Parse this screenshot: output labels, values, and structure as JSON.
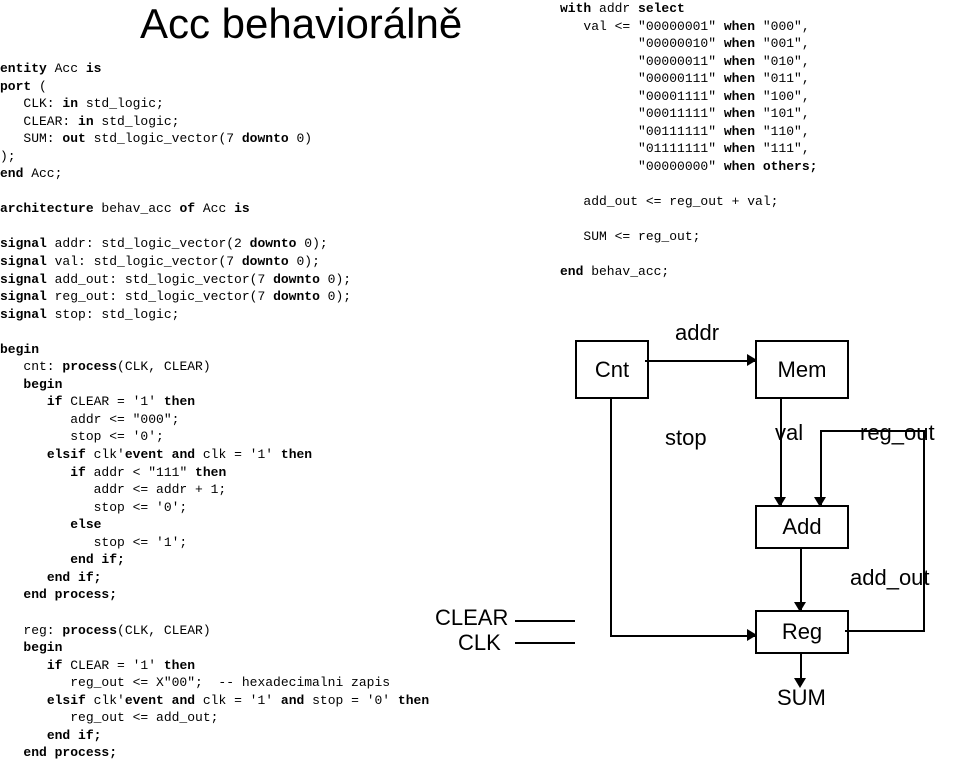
{
  "title": "Acc behaviorálně",
  "code_left": "<span class='kw'>entity</span> Acc <span class='kw'>is</span>\n<span class='kw'>port</span> (\n   CLK: <span class='kw'>in</span> std_logic;\n   CLEAR: <span class='kw'>in</span> std_logic;\n   SUM: <span class='kw'>out</span> std_logic_vector(7 <span class='kw'>downto</span> 0)\n);\n<span class='kw'>end</span> Acc;\n\n<span class='kw'>architecture</span> behav_acc <span class='kw'>of</span> Acc <span class='kw'>is</span>\n\n<span class='kw'>signal</span> addr: std_logic_vector(2 <span class='kw'>downto</span> 0);\n<span class='kw'>signal</span> val: std_logic_vector(7 <span class='kw'>downto</span> 0);\n<span class='kw'>signal</span> add_out: std_logic_vector(7 <span class='kw'>downto</span> 0);\n<span class='kw'>signal</span> reg_out: std_logic_vector(7 <span class='kw'>downto</span> 0);\n<span class='kw'>signal</span> stop: std_logic;\n\n<span class='kw'>begin</span>\n   cnt: <span class='kw'>process</span>(CLK, CLEAR)\n   <span class='kw'>begin</span>\n      <span class='kw'>if</span> CLEAR = '1' <span class='kw'>then</span>\n         addr <= \"000\";\n         stop <= '0';\n      <span class='kw'>elsif</span> clk'<span class='kw'>event and</span> clk = '1' <span class='kw'>then</span>\n         <span class='kw'>if</span> addr < \"111\" <span class='kw'>then</span>\n            addr <= addr + 1;\n            stop <= '0';\n         <span class='kw'>else</span>\n            stop <= '1';\n         <span class='kw'>end if;</span>\n      <span class='kw'>end if;</span>\n   <span class='kw'>end process;</span>\n\n   reg: <span class='kw'>process</span>(CLK, CLEAR)\n   <span class='kw'>begin</span>\n      <span class='kw'>if</span> CLEAR = '1' <span class='kw'>then</span>\n         reg_out <= X\"00\";  -- hexadecimalni zapis\n      <span class='kw'>elsif</span> clk'<span class='kw'>event and</span> clk = '1' <span class='kw'>and</span> stop = '0' <span class='kw'>then</span>\n         reg_out <= add_out;\n      <span class='kw'>end if;</span>\n   <span class='kw'>end process;</span>",
  "code_right": "<span class='kw'>with</span> addr <span class='kw'>select</span>\n   val <= \"00000001\" <span class='kw'>when</span> \"000\",\n          \"00000010\" <span class='kw'>when</span> \"001\",\n          \"00000011\" <span class='kw'>when</span> \"010\",\n          \"00000111\" <span class='kw'>when</span> \"011\",\n          \"00001111\" <span class='kw'>when</span> \"100\",\n          \"00011111\" <span class='kw'>when</span> \"101\",\n          \"00111111\" <span class='kw'>when</span> \"110\",\n          \"01111111\" <span class='kw'>when</span> \"111\",\n          \"00000000\" <span class='kw'>when others;</span>\n\n   add_out <= reg_out + val;\n\n   SUM <= reg_out;\n\n<span class='kw'>end</span> behav_acc;",
  "diagram": {
    "cnt": "Cnt",
    "mem": "Mem",
    "add": "Add",
    "reg": "Reg",
    "addr": "addr",
    "stop": "stop",
    "val": "val",
    "reg_out": "reg_out",
    "add_out": "add_out",
    "sum": "SUM",
    "clear": "CLEAR",
    "clk": "CLK"
  }
}
